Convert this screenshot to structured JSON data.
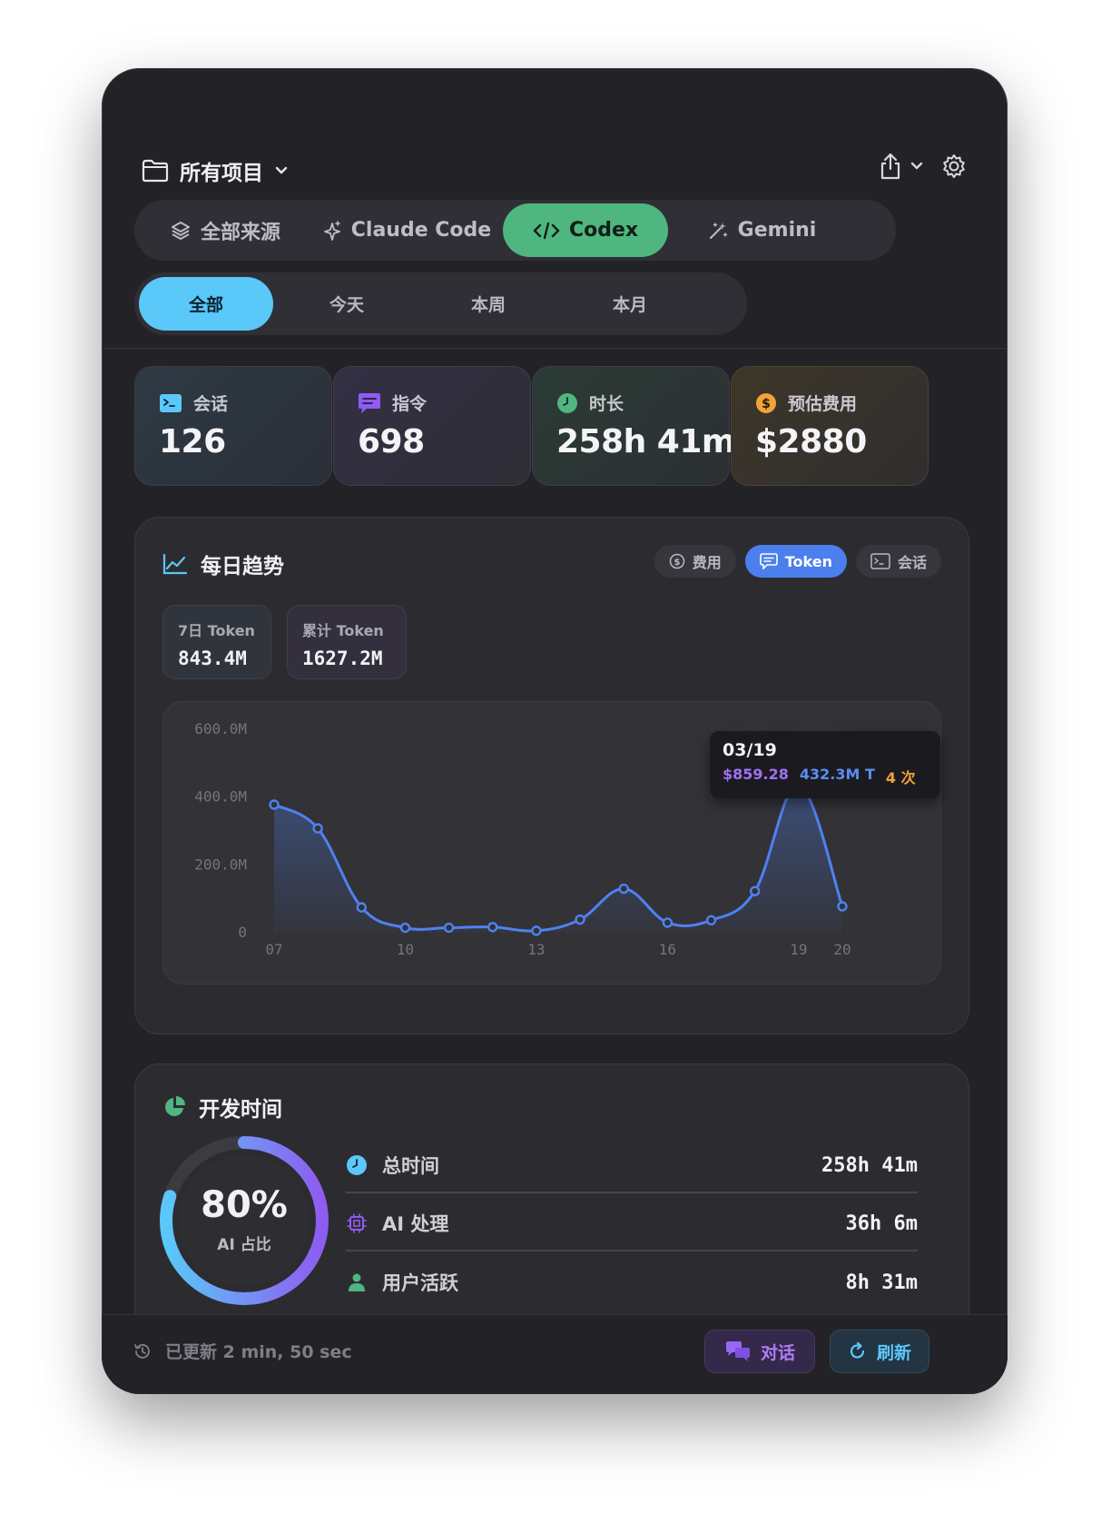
{
  "header": {
    "project_label": "所有项目",
    "icons": [
      "folder-icon",
      "chevron-down-icon",
      "share-icon",
      "gear-icon"
    ]
  },
  "sources": {
    "items": [
      {
        "label": "全部来源",
        "icon": "layers-icon"
      },
      {
        "label": "Claude Code",
        "icon": "sparkle-icon"
      },
      {
        "label": "Codex",
        "icon": "code-icon"
      },
      {
        "label": "Gemini",
        "icon": "magic-wand-icon"
      }
    ],
    "active": "Codex",
    "active_color": "#4fb67f"
  },
  "periods": {
    "items": [
      "全部",
      "今天",
      "本周",
      "本月"
    ],
    "active": "全部",
    "active_color": "#5ac8f8"
  },
  "stats": [
    {
      "label": "会话",
      "value": "126",
      "icon": "terminal-icon",
      "color": "#5ac8f8"
    },
    {
      "label": "指令",
      "value": "698",
      "icon": "message-icon",
      "color": "#8e5cf0"
    },
    {
      "label": "时长",
      "value": "258h 41m",
      "icon": "clock-icon",
      "color": "#4fb67f"
    },
    {
      "label": "预估费用",
      "value": "$2880",
      "icon": "dollar-icon",
      "color": "#f0a33a"
    }
  ],
  "trend": {
    "title": "每日趋势",
    "metric_tabs": [
      "费用",
      "Token",
      "会话"
    ],
    "active_metric": "Token",
    "summary": [
      {
        "label": "7日 Token",
        "value": "843.4M"
      },
      {
        "label": "累计 Token",
        "value": "1627.2M"
      }
    ],
    "tooltip": {
      "date": "03/19",
      "cost": "$859.28",
      "tokens": "432.3M T",
      "count": "4 次"
    }
  },
  "chart_data": {
    "type": "area",
    "x": [
      "07",
      "08",
      "09",
      "10",
      "11",
      "12",
      "13",
      "14",
      "15",
      "16",
      "17",
      "18",
      "19",
      "20"
    ],
    "x_tick_labels": [
      "07",
      "10",
      "13",
      "16",
      "19",
      "20"
    ],
    "y_tick_labels": [
      "0",
      "200.0M",
      "400.0M",
      "600.0M"
    ],
    "series": [
      {
        "values_millions": [
          375,
          305,
          72,
          12,
          12,
          14,
          3,
          36,
          127,
          27,
          34,
          120,
          432,
          75
        ],
        "color": "#4f81f0"
      }
    ],
    "ylim": [
      0,
      600
    ],
    "grid": true,
    "highlight": "19"
  },
  "devtime": {
    "title": "开发时间",
    "ring_value": "80%",
    "ring_label": "AI 占比",
    "ring_fraction": 0.8,
    "rows": [
      {
        "label": "总时间",
        "value": "258h  41m",
        "icon": "clock-icon",
        "color": "#5ac8f8"
      },
      {
        "label": "AI 处理",
        "value": "36h  6m",
        "icon": "cpu-icon",
        "color": "#8e5cf0"
      },
      {
        "label": "用户活跃",
        "value": "8h  31m",
        "icon": "person-icon",
        "color": "#4fb67f"
      }
    ]
  },
  "footer": {
    "status": "已更新 2 min, 50 sec",
    "chat_button": "对话",
    "refresh_button": "刷新"
  }
}
